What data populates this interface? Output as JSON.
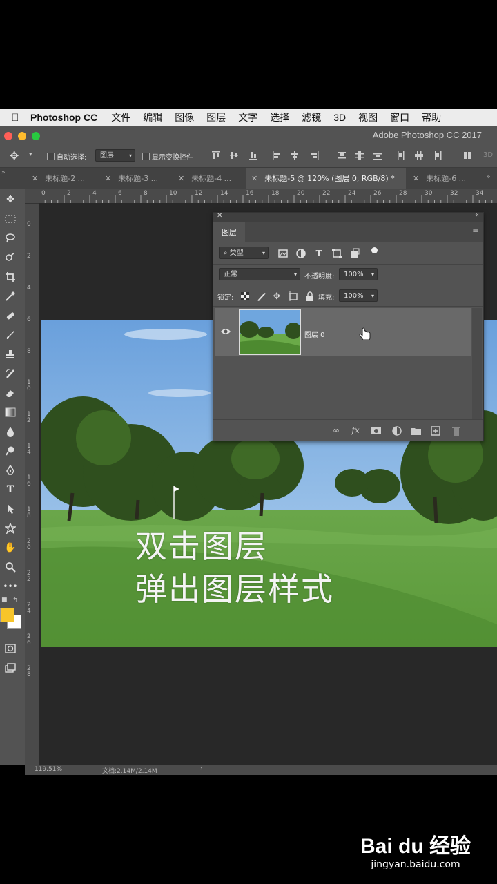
{
  "menubar": {
    "app_name": "Photoshop CC",
    "items": [
      "文件",
      "编辑",
      "图像",
      "图层",
      "文字",
      "选择",
      "滤镜",
      "3D",
      "视图",
      "窗口",
      "帮助"
    ]
  },
  "window": {
    "title": "Adobe Photoshop CC 2017",
    "traffic_colors": [
      "#ff5f57",
      "#febc2e",
      "#28c840"
    ]
  },
  "options_bar": {
    "auto_select_label": "自动选择:",
    "auto_select_value": "图层",
    "show_transform_label": "显示变换控件",
    "extra": "3D"
  },
  "tabs": [
    {
      "label": "未标题-2 ...",
      "active": false
    },
    {
      "label": "未标题-3 ...",
      "active": false
    },
    {
      "label": "未标题-4 ...",
      "active": false
    },
    {
      "label": "未标题-5 @ 120% (图层 0, RGB/8) *",
      "active": true
    },
    {
      "label": "未标题-6 ...",
      "active": false
    }
  ],
  "ruler_h": [
    "0",
    "2",
    "4",
    "6",
    "8",
    "10",
    "12",
    "14",
    "16",
    "18",
    "20",
    "22",
    "24",
    "26",
    "28",
    "30",
    "32",
    "34"
  ],
  "ruler_v": [
    "0",
    "2",
    "4",
    "6",
    "8",
    "1 0",
    "1 2",
    "1 4",
    "1 6",
    "1 8",
    "2 0",
    "2 2",
    "2 4",
    "2 6",
    "2 8"
  ],
  "overlay_text": {
    "line1": "双击图层",
    "line2": "弹出图层样式"
  },
  "layers_panel": {
    "tab_label": "图层",
    "filter_value": "类型",
    "blend_mode": "正常",
    "opacity_label": "不透明度:",
    "opacity_value": "100%",
    "lock_label": "锁定:",
    "fill_label": "填充:",
    "fill_value": "100%",
    "layer_name": "图层 0",
    "footer_fx": "fx"
  },
  "status_bar": {
    "zoom": "119.51%",
    "doc": "文档:2.14M/2.14M"
  },
  "watermark": {
    "logo": "Bai du 经验",
    "url": "jingyan.baidu.com"
  }
}
